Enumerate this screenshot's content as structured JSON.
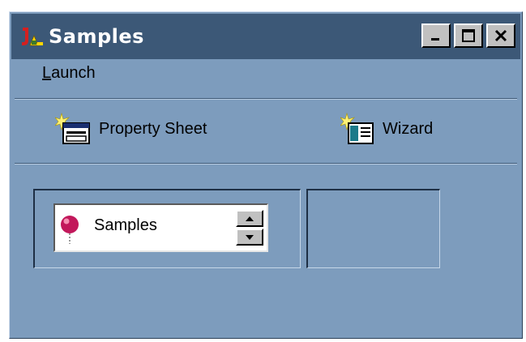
{
  "window": {
    "title": "Samples",
    "controls": [
      "minimize-icon",
      "maximize-icon",
      "close-icon"
    ]
  },
  "menu": {
    "launch_first": "L",
    "launch_rest": "aunch"
  },
  "actions": {
    "property_sheet": {
      "label": "Property Sheet",
      "icon": "property-sheet-icon"
    },
    "wizard": {
      "label": "Wizard",
      "icon": "wizard-icon"
    }
  },
  "spinner": {
    "value": "Samples",
    "icon": "red-pin-icon"
  },
  "colors": {
    "window_bg": "#7d9cbd",
    "titlebar_bg": "#3c5877",
    "button_face": "#c0c0c0"
  }
}
